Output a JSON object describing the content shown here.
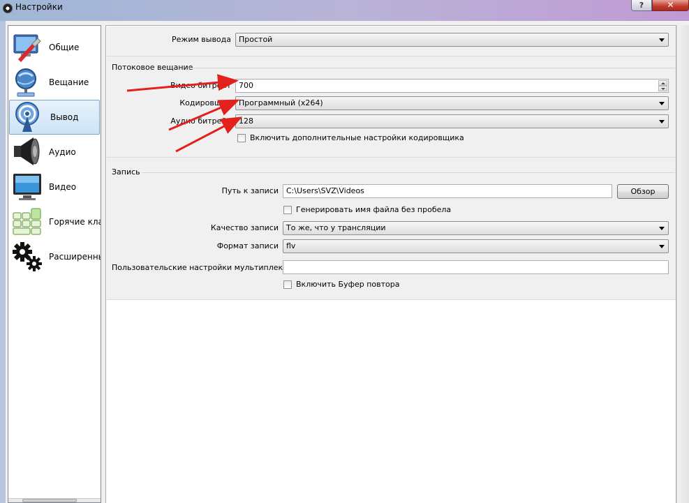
{
  "window": {
    "title": "Настройки",
    "help_label": "?",
    "close_label": "✕"
  },
  "sidebar": {
    "items": [
      {
        "label": "Общие",
        "icon": "general-icon"
      },
      {
        "label": "Вещание",
        "icon": "broadcast-icon"
      },
      {
        "label": "Вывод",
        "icon": "output-icon",
        "active": true
      },
      {
        "label": "Аудио",
        "icon": "speaker-icon"
      },
      {
        "label": "Видео",
        "icon": "monitor-icon"
      },
      {
        "label": "Горячие клав",
        "icon": "hotkeys-icon"
      },
      {
        "label": "Расширенны",
        "icon": "gears-icon"
      }
    ]
  },
  "output": {
    "mode_label": "Режим вывода",
    "mode_value": "Простой",
    "streaming": {
      "title": "Потоковое вещание",
      "video_bitrate_label": "Видео битрейт",
      "video_bitrate_value": "700",
      "encoder_label": "Кодировщик",
      "encoder_value": "Программный (x264)",
      "audio_bitrate_label": "Аудио битрейт",
      "audio_bitrate_value": "128",
      "advanced_encoder_label": "Включить дополнительные настройки кодировщика"
    },
    "recording": {
      "title": "Запись",
      "path_label": "Путь к записи",
      "path_value": "C:\\Users\\SVZ\\Videos",
      "browse_label": "Обзор",
      "no_space_label": "Генерировать имя файла без пробела",
      "quality_label": "Качество записи",
      "quality_value": "То же, что у трансляции",
      "format_label": "Формат записи",
      "format_value": "flv",
      "muxer_label": "Пользовательские настройки мультиплексора",
      "muxer_value": "",
      "replay_buffer_label": "Включить Буфер повтора"
    }
  },
  "colors": {
    "annotation_arrow": "#e3201b",
    "active_item": "#cde4f7"
  }
}
